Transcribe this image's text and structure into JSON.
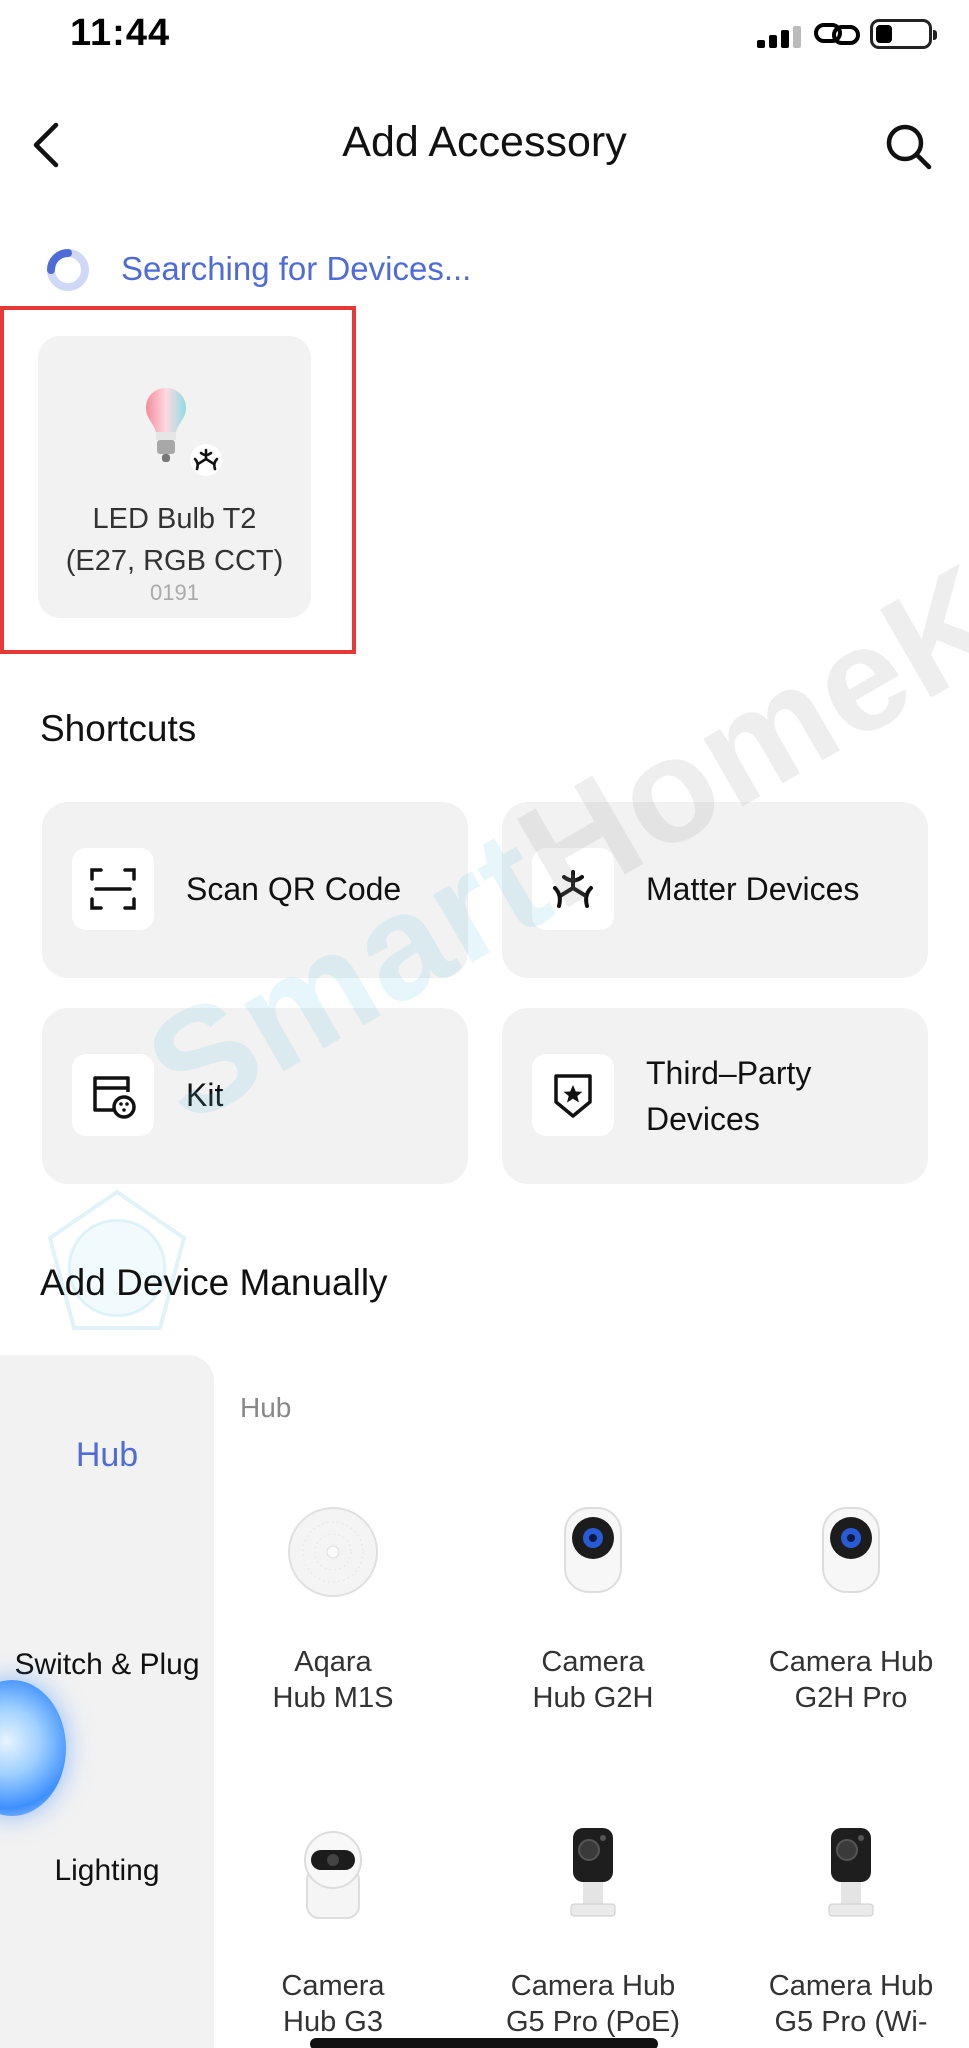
{
  "status_bar": {
    "time": "11:44",
    "signal_bars": 3,
    "battery_percent": 25
  },
  "header": {
    "title": "Add Accessory"
  },
  "search_status": "Searching for Devices...",
  "found_device": {
    "name_line1": "LED Bulb T2",
    "name_line2": "(E27, RGB CCT)",
    "code": "0191",
    "badge_icon": "matter-icon"
  },
  "colors": {
    "accent": "#4f6bd8",
    "highlight": "#e53935",
    "tile_bg": "#f2f2f2"
  },
  "shortcuts": {
    "title": "Shortcuts",
    "items": [
      {
        "label": "Scan QR Code",
        "icon": "qr-scan-icon"
      },
      {
        "label": "Matter Devices",
        "icon": "matter-icon"
      },
      {
        "label": "Kit",
        "icon": "kit-icon"
      },
      {
        "label_line1": "Third–Party",
        "label_line2": "Devices",
        "icon": "shield-star-icon"
      }
    ]
  },
  "manual": {
    "title": "Add Device Manually",
    "categories": [
      "Hub",
      "Switch & Plug",
      "Lighting"
    ],
    "active_category": "Hub",
    "group_label": "Hub",
    "products": [
      {
        "line1": "Aqara",
        "line2": "Hub M1S"
      },
      {
        "line1": "Camera",
        "line2": "Hub G2H"
      },
      {
        "line1": "Camera Hub",
        "line2": "G2H Pro"
      },
      {
        "line1": "Camera",
        "line2": "Hub G3"
      },
      {
        "line1": "Camera Hub",
        "line2": "G5 Pro (PoE)"
      },
      {
        "line1": "Camera Hub",
        "line2": "G5 Pro (Wi-"
      }
    ]
  },
  "watermark": {
    "part1": "Smart",
    "part2": "HomeKit"
  }
}
